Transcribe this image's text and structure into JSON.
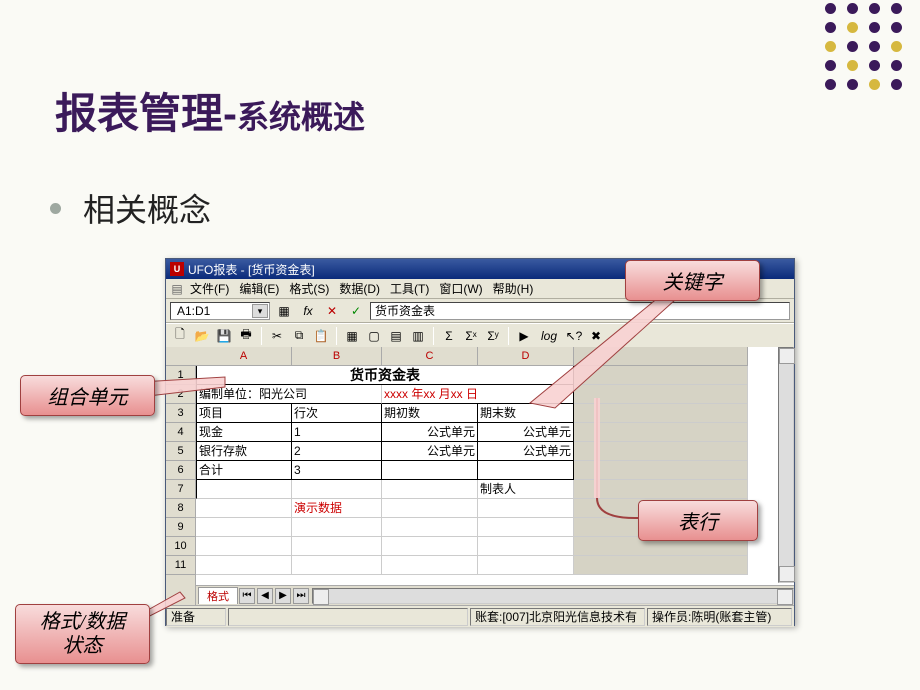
{
  "slide": {
    "title_main": "报表管理",
    "title_dash": "-",
    "title_sub": "系统概述",
    "bullet": "相关概念"
  },
  "callout": {
    "keyword": "关键字",
    "combo": "组合单元",
    "row": "表行",
    "format": "格式/数据状态"
  },
  "app": {
    "title": "UFO报表 - [货币资金表]",
    "icon_letter": "U",
    "menu": {
      "file": "文件(F)",
      "edit": "编辑(E)",
      "format": "格式(S)",
      "data": "数据(D)",
      "tool": "工具(T)",
      "window": "窗口(W)",
      "help": "帮助(H)"
    },
    "cell_ref": "A1:D1",
    "formula": "货币资金表",
    "fx": "fx",
    "columns": [
      "A",
      "B",
      "C",
      "D"
    ],
    "sheet_title": "货币资金表",
    "row2_unit": "编制单位：阳光公司",
    "row2_date": "xxxx 年xx 月xx 日",
    "headers": {
      "item": "项目",
      "seq": "行次",
      "begin": "期初数",
      "end": "期末数"
    },
    "rows": [
      {
        "item": "现金",
        "seq": "1",
        "begin": "公式单元",
        "end": "公式单元"
      },
      {
        "item": "银行存款",
        "seq": "2",
        "begin": "公式单元",
        "end": "公式单元"
      },
      {
        "item": "合计",
        "seq": "3",
        "begin": "",
        "end": ""
      }
    ],
    "maker": "制表人",
    "demo": "演示数据",
    "tab": "格式",
    "status": {
      "ready": "准备",
      "account": "账套:[007]北京阳光信息技术有",
      "operator": "操作员:陈明(账套主管)"
    }
  }
}
